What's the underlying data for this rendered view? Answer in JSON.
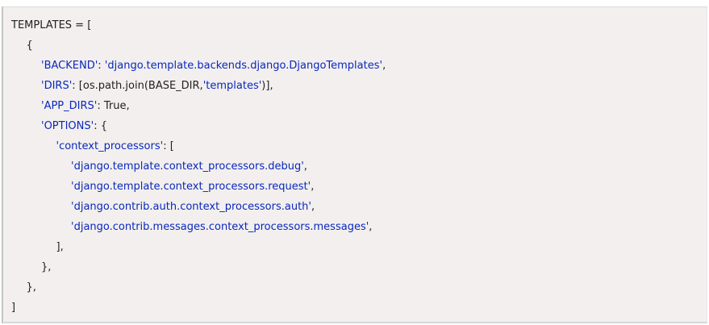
{
  "code_block": {
    "lines": [
      [
        {
          "t": "TEMPLATES = [",
          "k": "txt"
        }
      ],
      [
        {
          "t": "{",
          "k": "txt"
        }
      ],
      [
        {
          "t": "'BACKEND'",
          "k": "str"
        },
        {
          "t": ": ",
          "k": "txt"
        },
        {
          "t": "'django.template.backends.django.DjangoTemplates'",
          "k": "str"
        },
        {
          "t": ",",
          "k": "txt"
        }
      ],
      [
        {
          "t": "'DIRS'",
          "k": "str"
        },
        {
          "t": ": [os.path.join(BASE_DIR,",
          "k": "txt"
        },
        {
          "t": "'templates'",
          "k": "str"
        },
        {
          "t": ")],",
          "k": "txt"
        }
      ],
      [
        {
          "t": "'APP_DIRS'",
          "k": "str"
        },
        {
          "t": ": True,",
          "k": "txt"
        }
      ],
      [
        {
          "t": "'OPTIONS'",
          "k": "str"
        },
        {
          "t": ": {",
          "k": "txt"
        }
      ],
      [
        {
          "t": "'context_processors'",
          "k": "str"
        },
        {
          "t": ": [",
          "k": "txt"
        }
      ],
      [
        {
          "t": "'django.template.context_processors.debug'",
          "k": "str"
        },
        {
          "t": ",",
          "k": "txt"
        }
      ],
      [
        {
          "t": "'django.template.context_processors.request'",
          "k": "str"
        },
        {
          "t": ",",
          "k": "txt"
        }
      ],
      [
        {
          "t": "'django.contrib.auth.context_processors.auth'",
          "k": "str"
        },
        {
          "t": ",",
          "k": "txt"
        }
      ],
      [
        {
          "t": "'django.contrib.messages.context_processors.messages'",
          "k": "str"
        },
        {
          "t": ",",
          "k": "txt"
        }
      ],
      [
        {
          "t": "],",
          "k": "txt"
        }
      ],
      [
        {
          "t": "},",
          "k": "txt"
        }
      ],
      [
        {
          "t": "},",
          "k": "txt"
        }
      ],
      [
        {
          "t": "]",
          "k": "txt"
        }
      ]
    ],
    "indent_levels": [
      0,
      1,
      2,
      2,
      2,
      2,
      3,
      4,
      4,
      4,
      4,
      3,
      2,
      1,
      0
    ]
  },
  "colors": {
    "background": "#f2efee",
    "string": "#0a28bd",
    "text": "#222222"
  }
}
